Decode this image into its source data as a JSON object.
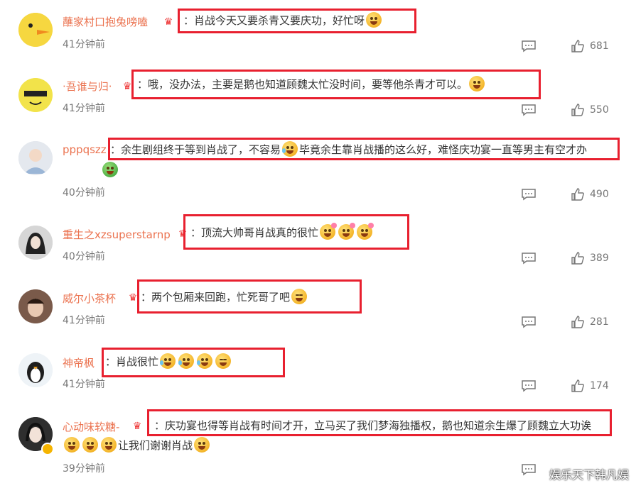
{
  "comments": [
    {
      "username": "蘸家村口抱兔嗙嗑",
      "text": "：肖战今天又要杀青又要庆功，好忙呀",
      "time": "41分钟前",
      "likes": "681",
      "avatar": "duck-avatar"
    },
    {
      "username": "·吾谁与归·",
      "text": "：哦，没办法，主要是鹅也知道顾魏太忙没时间，要等他杀青才可以。",
      "time": "41分钟前",
      "likes": "550",
      "avatar": "spongebob-avatar"
    },
    {
      "username": "pppqszz",
      "text": "：余生剧组终于等到肖战了，不容易",
      "text2": "毕竟余生靠肖战播的这么好，难怪庆功宴一直等男主有空才办",
      "time": "40分钟前",
      "likes": "490",
      "avatar": "person-avatar"
    },
    {
      "username": "重生之xzsuperstarnp",
      "text": "：顶流大帅哥肖战真的很忙",
      "time": "40分钟前",
      "likes": "389",
      "avatar": "girl-avatar"
    },
    {
      "username": "威尔小茶杯",
      "text": "：两个包厢来回跑，忙死哥了吧",
      "time": "41分钟前",
      "likes": "281",
      "avatar": "photo-avatar"
    },
    {
      "username": "神帝枫",
      "text": "：肖战很忙",
      "time": "41分钟前",
      "likes": "174",
      "avatar": "penguin-avatar"
    },
    {
      "username": "心动味软糖-",
      "text": "：庆功宴也得等肖战有时间才开，立马买了我们梦海独播权，鹅也知道余生爆了顾魏立大功诶",
      "text2": "让我们谢谢肖战",
      "time": "39分钟前",
      "likes": "",
      "avatar": "woman-avatar"
    }
  ],
  "watermark": "娱乐天下韩凡娱",
  "colors": {
    "username": "#eb7350",
    "highlight_border": "#e8202f",
    "meta": "#777777"
  }
}
